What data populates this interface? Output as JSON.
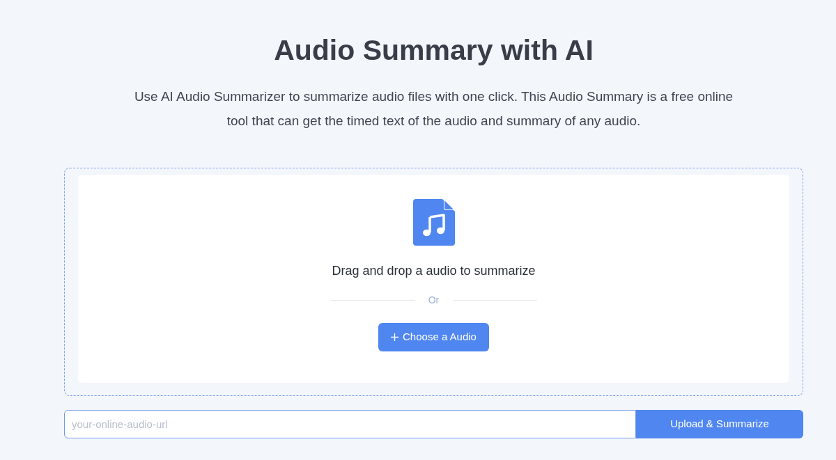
{
  "header": {
    "title": "Audio Summary with AI",
    "description": "Use AI Audio Summarizer to summarize audio files with one click. This Audio Summary is a free online tool that can get the timed text of the audio and summary of any audio."
  },
  "dropzone": {
    "prompt": "Drag and drop a audio to summarize",
    "divider_label": "Or",
    "choose_button": "Choose a Audio"
  },
  "url_form": {
    "placeholder": "your-online-audio-url",
    "submit_button": "Upload & Summarize"
  }
}
